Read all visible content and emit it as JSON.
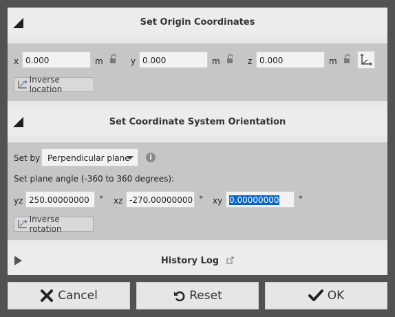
{
  "origin": {
    "title": "Set Origin Coordinates",
    "x_label": "x",
    "x_value": "0.000",
    "y_label": "y",
    "y_value": "0.000",
    "z_label": "z",
    "z_value": "0.000",
    "unit": "m",
    "inverse_label": "Inverse location"
  },
  "orientation": {
    "title": "Set Coordinate System Orientation",
    "set_by_label": "Set by",
    "set_by_value": "Perpendicular plane",
    "info_icon": "i",
    "angle_label": "Set plane angle (-360 to 360 degrees):",
    "yz_label": "yz",
    "yz_value": "250.00000000",
    "xz_label": "xz",
    "xz_value": "-270.00000000",
    "xy_label": "xy",
    "xy_value": "0.00000000",
    "deg": "°",
    "inverse_label": "Inverse rotation"
  },
  "history": {
    "title": "History Log"
  },
  "buttons": {
    "cancel": "Cancel",
    "reset": "Reset",
    "ok": "OK"
  }
}
